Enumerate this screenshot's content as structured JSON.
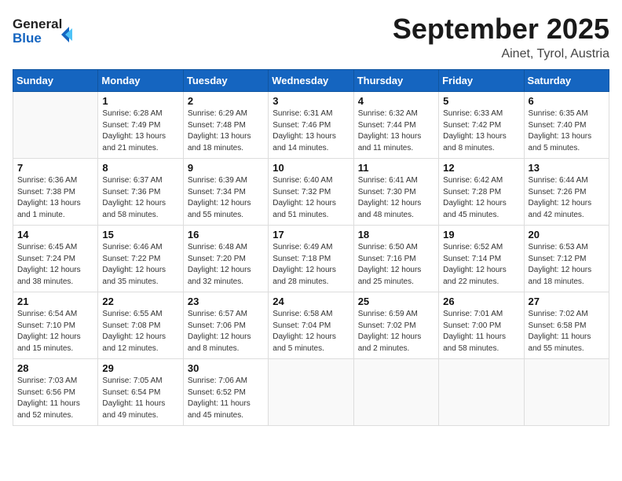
{
  "header": {
    "logo_line1": "General",
    "logo_line2": "Blue",
    "month": "September 2025",
    "location": "Ainet, Tyrol, Austria"
  },
  "days_of_week": [
    "Sunday",
    "Monday",
    "Tuesday",
    "Wednesday",
    "Thursday",
    "Friday",
    "Saturday"
  ],
  "weeks": [
    [
      {
        "day": "",
        "info": ""
      },
      {
        "day": "1",
        "info": "Sunrise: 6:28 AM\nSunset: 7:49 PM\nDaylight: 13 hours\nand 21 minutes."
      },
      {
        "day": "2",
        "info": "Sunrise: 6:29 AM\nSunset: 7:48 PM\nDaylight: 13 hours\nand 18 minutes."
      },
      {
        "day": "3",
        "info": "Sunrise: 6:31 AM\nSunset: 7:46 PM\nDaylight: 13 hours\nand 14 minutes."
      },
      {
        "day": "4",
        "info": "Sunrise: 6:32 AM\nSunset: 7:44 PM\nDaylight: 13 hours\nand 11 minutes."
      },
      {
        "day": "5",
        "info": "Sunrise: 6:33 AM\nSunset: 7:42 PM\nDaylight: 13 hours\nand 8 minutes."
      },
      {
        "day": "6",
        "info": "Sunrise: 6:35 AM\nSunset: 7:40 PM\nDaylight: 13 hours\nand 5 minutes."
      }
    ],
    [
      {
        "day": "7",
        "info": "Sunrise: 6:36 AM\nSunset: 7:38 PM\nDaylight: 13 hours\nand 1 minute."
      },
      {
        "day": "8",
        "info": "Sunrise: 6:37 AM\nSunset: 7:36 PM\nDaylight: 12 hours\nand 58 minutes."
      },
      {
        "day": "9",
        "info": "Sunrise: 6:39 AM\nSunset: 7:34 PM\nDaylight: 12 hours\nand 55 minutes."
      },
      {
        "day": "10",
        "info": "Sunrise: 6:40 AM\nSunset: 7:32 PM\nDaylight: 12 hours\nand 51 minutes."
      },
      {
        "day": "11",
        "info": "Sunrise: 6:41 AM\nSunset: 7:30 PM\nDaylight: 12 hours\nand 48 minutes."
      },
      {
        "day": "12",
        "info": "Sunrise: 6:42 AM\nSunset: 7:28 PM\nDaylight: 12 hours\nand 45 minutes."
      },
      {
        "day": "13",
        "info": "Sunrise: 6:44 AM\nSunset: 7:26 PM\nDaylight: 12 hours\nand 42 minutes."
      }
    ],
    [
      {
        "day": "14",
        "info": "Sunrise: 6:45 AM\nSunset: 7:24 PM\nDaylight: 12 hours\nand 38 minutes."
      },
      {
        "day": "15",
        "info": "Sunrise: 6:46 AM\nSunset: 7:22 PM\nDaylight: 12 hours\nand 35 minutes."
      },
      {
        "day": "16",
        "info": "Sunrise: 6:48 AM\nSunset: 7:20 PM\nDaylight: 12 hours\nand 32 minutes."
      },
      {
        "day": "17",
        "info": "Sunrise: 6:49 AM\nSunset: 7:18 PM\nDaylight: 12 hours\nand 28 minutes."
      },
      {
        "day": "18",
        "info": "Sunrise: 6:50 AM\nSunset: 7:16 PM\nDaylight: 12 hours\nand 25 minutes."
      },
      {
        "day": "19",
        "info": "Sunrise: 6:52 AM\nSunset: 7:14 PM\nDaylight: 12 hours\nand 22 minutes."
      },
      {
        "day": "20",
        "info": "Sunrise: 6:53 AM\nSunset: 7:12 PM\nDaylight: 12 hours\nand 18 minutes."
      }
    ],
    [
      {
        "day": "21",
        "info": "Sunrise: 6:54 AM\nSunset: 7:10 PM\nDaylight: 12 hours\nand 15 minutes."
      },
      {
        "day": "22",
        "info": "Sunrise: 6:55 AM\nSunset: 7:08 PM\nDaylight: 12 hours\nand 12 minutes."
      },
      {
        "day": "23",
        "info": "Sunrise: 6:57 AM\nSunset: 7:06 PM\nDaylight: 12 hours\nand 8 minutes."
      },
      {
        "day": "24",
        "info": "Sunrise: 6:58 AM\nSunset: 7:04 PM\nDaylight: 12 hours\nand 5 minutes."
      },
      {
        "day": "25",
        "info": "Sunrise: 6:59 AM\nSunset: 7:02 PM\nDaylight: 12 hours\nand 2 minutes."
      },
      {
        "day": "26",
        "info": "Sunrise: 7:01 AM\nSunset: 7:00 PM\nDaylight: 11 hours\nand 58 minutes."
      },
      {
        "day": "27",
        "info": "Sunrise: 7:02 AM\nSunset: 6:58 PM\nDaylight: 11 hours\nand 55 minutes."
      }
    ],
    [
      {
        "day": "28",
        "info": "Sunrise: 7:03 AM\nSunset: 6:56 PM\nDaylight: 11 hours\nand 52 minutes."
      },
      {
        "day": "29",
        "info": "Sunrise: 7:05 AM\nSunset: 6:54 PM\nDaylight: 11 hours\nand 49 minutes."
      },
      {
        "day": "30",
        "info": "Sunrise: 7:06 AM\nSunset: 6:52 PM\nDaylight: 11 hours\nand 45 minutes."
      },
      {
        "day": "",
        "info": ""
      },
      {
        "day": "",
        "info": ""
      },
      {
        "day": "",
        "info": ""
      },
      {
        "day": "",
        "info": ""
      }
    ]
  ]
}
